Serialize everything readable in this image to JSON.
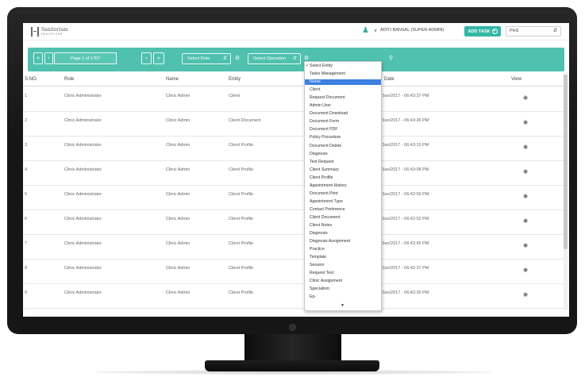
{
  "header": {
    "logo_text": "Sanitorium",
    "logo_sub": "HEALTH EHR",
    "user_name": "ADITI BANSAL (SUPER ADMIN)",
    "add_task_label": "ADD TASK",
    "org_value": "PHS"
  },
  "toolbar": {
    "first_label": "«",
    "prev_label": "‹",
    "page_label": "Page 1 of 1707",
    "next_label": "›",
    "last_label": "»",
    "role_select": "Select Role",
    "operation_select": "Select Operation"
  },
  "table": {
    "columns": [
      "S.NO.",
      "Role",
      "Name",
      "Entity",
      "Date",
      "View"
    ],
    "rows": [
      {
        "sno": "1",
        "role": "Clinic Administrator",
        "name": "Clinic Admin",
        "entity": "Client",
        "date": "07/Jan/2017 - 06:43:37 PM"
      },
      {
        "sno": "2",
        "role": "Clinic Administrator",
        "name": "Clinic Admin",
        "entity": "Client Document",
        "date": "07/Jan/2017 - 06:43:26 PM"
      },
      {
        "sno": "3",
        "role": "Clinic Administrator",
        "name": "Clinic Admin",
        "entity": "Client Profile",
        "date": "07/Jan/2017 - 06:43:15 PM"
      },
      {
        "sno": "4",
        "role": "Clinic Administrator",
        "name": "Clinic Admin",
        "entity": "Client Profile",
        "date": "07/Jan/2017 - 06:43:08 PM"
      },
      {
        "sno": "5",
        "role": "Clinic Administrator",
        "name": "Clinic Admin",
        "entity": "Client Profile",
        "date": "07/Jan/2017 - 06:42:59 PM"
      },
      {
        "sno": "6",
        "role": "Clinic Administrator",
        "name": "Clinic Admin",
        "entity": "Client Profile",
        "date": "07/Jan/2017 - 06:42:52 PM"
      },
      {
        "sno": "7",
        "role": "Clinic Administrator",
        "name": "Clinic Admin",
        "entity": "Client Profile",
        "date": "07/Jan/2017 - 06:42:45 PM"
      },
      {
        "sno": "8",
        "role": "Clinic Administrator",
        "name": "Clinic Admin",
        "entity": "Client Profile",
        "date": "07/Jan/2017 - 06:42:37 PM"
      },
      {
        "sno": "9",
        "role": "Clinic Administrator",
        "name": "Clinic Admin",
        "entity": "Client Profile",
        "date": "07/Jan/2017 - 06:42:30 PM"
      }
    ]
  },
  "entity_dropdown": {
    "checked_index": 0,
    "selected_index": 2,
    "options": [
      "Select Entity",
      "Tasks Management",
      "Nurse",
      "Client",
      "Request Document",
      "Admin User",
      "Document Download",
      "Document Form",
      "Document PDF",
      "Policy Procedure",
      "Document Delete",
      "Diagnosis",
      "Test Request",
      "Client Summary",
      "Client Profile",
      "Appointment History",
      "Document Print",
      "Appointment Type",
      "Contact Preference",
      "Client Document",
      "Client Notes",
      "Diagnosis",
      "Diagnosis Assignment",
      "Practice",
      "Template",
      "Session",
      "Request Test",
      "Clinic Assignment",
      "Specialism",
      "Ep-"
    ],
    "more_indicator": "▼"
  },
  "colors": {
    "accent": "#4fc1ae",
    "button": "#35b7a5",
    "dropdown_highlight": "#3b7fe0",
    "bezel": "#161616"
  }
}
